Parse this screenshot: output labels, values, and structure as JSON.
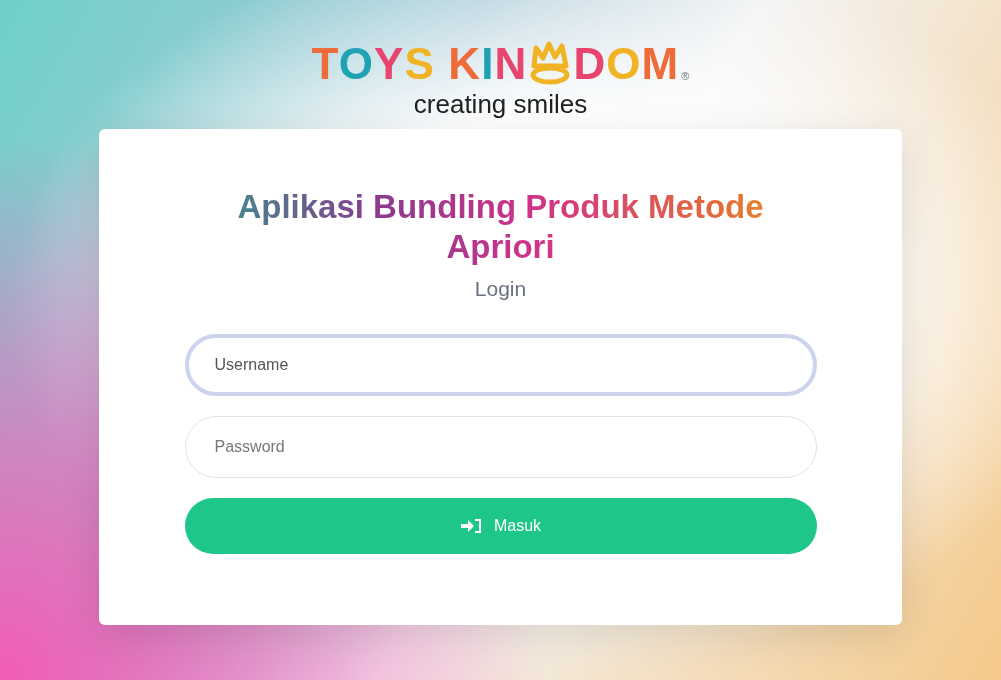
{
  "logo": {
    "wordmark_start": "TOYS KIN",
    "wordmark_end": "DOM",
    "registered": "®",
    "tagline": "creating smiles"
  },
  "card": {
    "title": "Aplikasi Bundling Produk Metode Apriori",
    "subtitle": "Login",
    "fields": [
      {
        "placeholder": "Username",
        "focused": true
      },
      {
        "placeholder": "Password",
        "focused": false
      }
    ],
    "submit": {
      "label": "Masuk"
    }
  }
}
